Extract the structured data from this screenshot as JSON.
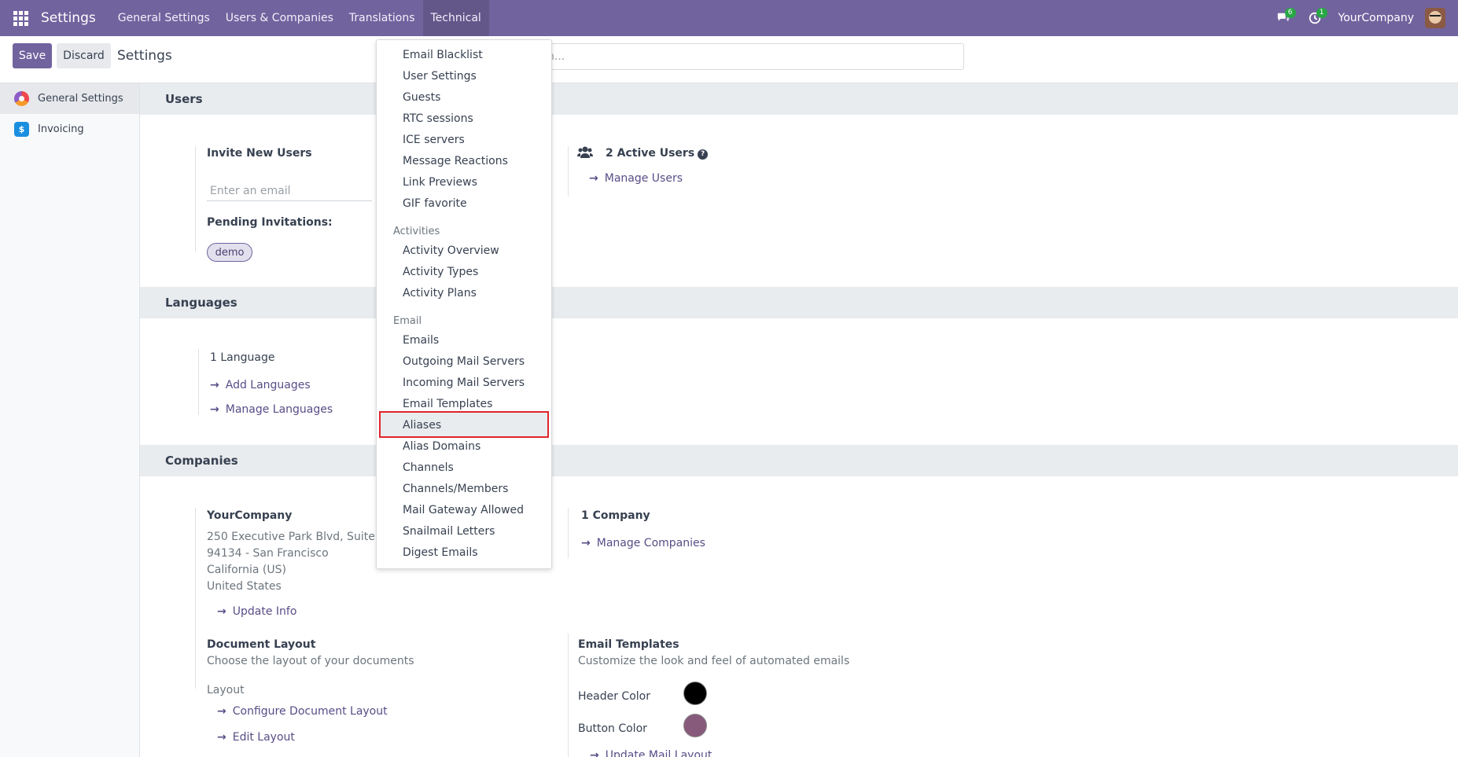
{
  "topbar": {
    "brand": "Settings",
    "menu": [
      "General Settings",
      "Users & Companies",
      "Translations",
      "Technical"
    ],
    "chat_badge": "6",
    "activity_badge": "1",
    "company": "YourCompany"
  },
  "control": {
    "save_label": "Save",
    "discard_label": "Discard",
    "breadcrumb": "Settings",
    "search_placeholder": "h..."
  },
  "sidebar": {
    "items": [
      {
        "label": "General Settings"
      },
      {
        "label": "Invoicing"
      }
    ]
  },
  "users": {
    "title": "Users",
    "invite_label": "Invite New Users",
    "email_placeholder": "Enter an email",
    "pending_label": "Pending Invitations:",
    "pending_tag": "demo",
    "active_users": "2 Active Users",
    "manage_users": "Manage Users"
  },
  "languages": {
    "title": "Languages",
    "count": "1 Language",
    "add": "Add Languages",
    "manage": "Manage Languages"
  },
  "companies": {
    "title": "Companies",
    "company_name": "YourCompany",
    "address": [
      "250 Executive Park Blvd, Suite 340",
      "94134 - San Francisco",
      "California (US)",
      "United States"
    ],
    "update_info": "Update Info",
    "count": "1 Company",
    "manage": "Manage Companies",
    "doc_layout_title": "Document Layout",
    "doc_layout_desc": "Choose the layout of your documents",
    "layout_label": "Layout",
    "configure_layout": "Configure Document Layout",
    "edit_layout": "Edit Layout",
    "email_templates_title": "Email Templates",
    "email_templates_desc": "Customize the look and feel of automated emails",
    "header_color_label": "Header Color",
    "header_color": "#000000",
    "button_color_label": "Button Color",
    "button_color": "#875a7b",
    "update_mail_layout": "Update Mail Layout"
  },
  "technical_menu": {
    "top_items": [
      "Email Blacklist",
      "User Settings",
      "Guests",
      "RTC sessions",
      "ICE servers",
      "Message Reactions",
      "Link Previews",
      "GIF favorite"
    ],
    "activities_header": "Activities",
    "activities_items": [
      "Activity Overview",
      "Activity Types",
      "Activity Plans"
    ],
    "email_header": "Email",
    "email_items": [
      "Emails",
      "Outgoing Mail Servers",
      "Incoming Mail Servers",
      "Email Templates",
      "Aliases",
      "Alias Domains",
      "Channels",
      "Channels/Members",
      "Mail Gateway Allowed",
      "Snailmail Letters",
      "Digest Emails"
    ],
    "highlighted": "Aliases"
  }
}
